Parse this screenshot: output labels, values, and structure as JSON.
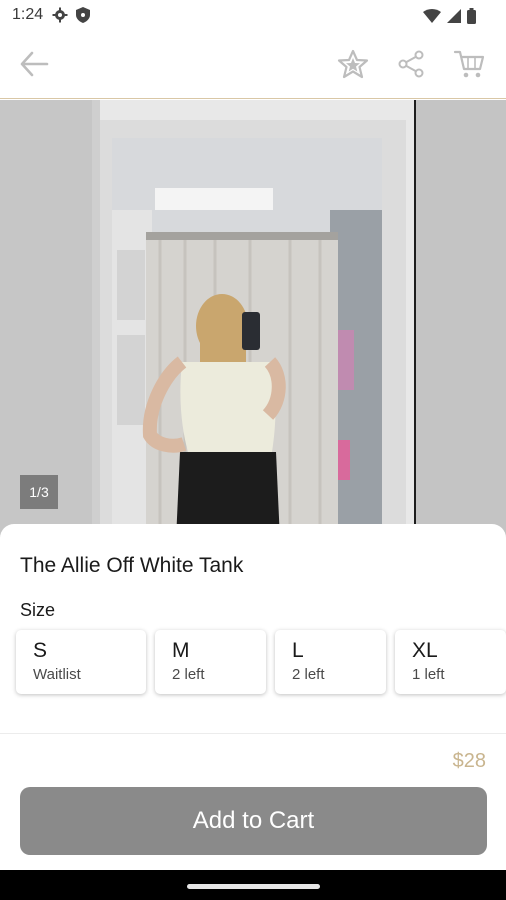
{
  "status_bar": {
    "time": "1:24",
    "icons": [
      "gear-icon",
      "shield-icon",
      "wifi-icon",
      "signal-icon",
      "battery-icon"
    ]
  },
  "app_bar": {
    "icons": [
      "back-arrow-icon",
      "star-icon",
      "share-icon",
      "cart-icon"
    ]
  },
  "gallery": {
    "counter": "1/3",
    "image_description_icon": "photo"
  },
  "product": {
    "title": "The Allie Off White Tank",
    "size_label": "Size",
    "sizes": [
      {
        "name": "S",
        "stock": "Waitlist"
      },
      {
        "name": "M",
        "stock": "2 left"
      },
      {
        "name": "L",
        "stock": "2 left"
      },
      {
        "name": "XL",
        "stock": "1 left"
      }
    ],
    "price": "$28",
    "add_to_cart_label": "Add to Cart"
  },
  "colors": {
    "accent_gold": "#c9b58f",
    "button_gray": "#8a8a8a"
  }
}
